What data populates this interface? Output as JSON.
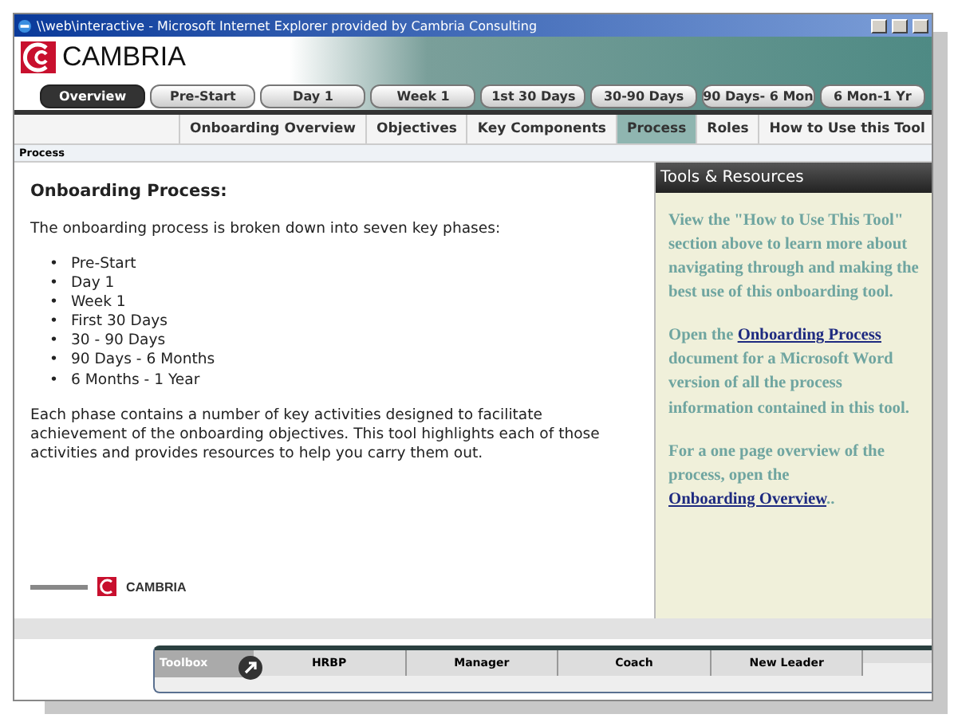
{
  "window": {
    "title": "\\\\web\\interactive - Microsoft Internet Explorer provided by Cambria Consulting"
  },
  "brand": {
    "name": "CAMBRIA"
  },
  "phase_tabs": [
    {
      "label": "Overview",
      "selected": true
    },
    {
      "label": "Pre-Start",
      "selected": false
    },
    {
      "label": "Day 1",
      "selected": false
    },
    {
      "label": "Week 1",
      "selected": false
    },
    {
      "label": "1st 30 Days",
      "selected": false
    },
    {
      "label": "30-90 Days",
      "selected": false
    },
    {
      "label": "90 Days- 6 Mon",
      "selected": false
    },
    {
      "label": "6 Mon-1 Yr",
      "selected": false
    }
  ],
  "section_tabs": [
    {
      "label": "Onboarding Overview",
      "selected": false
    },
    {
      "label": "Objectives",
      "selected": false
    },
    {
      "label": "Key Components",
      "selected": false
    },
    {
      "label": "Process",
      "selected": true
    },
    {
      "label": "Roles",
      "selected": false
    },
    {
      "label": "How to Use this Tool",
      "selected": false
    }
  ],
  "breadcrumb": "Process",
  "main": {
    "bullet": "•",
    "heading": "Onboarding Process:",
    "intro": "The onboarding process is broken down into seven key phases:",
    "phases": [
      "Pre-Start",
      "Day 1",
      "Week 1",
      "First 30 Days",
      "30 - 90 Days",
      "90 Days - 6 Months",
      "6 Months - 1 Year"
    ],
    "summary": "Each phase contains a number of key activities designed to facilitate achievement of the onboarding objectives. This tool highlights each of those activities and provides resources to help you carry them out.",
    "footer_brand": "CAMBRIA"
  },
  "sidebar": {
    "title": "Tools & Resources",
    "paragraphs": [
      {
        "before": "View the \"How to Use This Tool\" section above to learn more about navigating through and making the best use of this onboarding tool."
      },
      {
        "before": "Open the ",
        "link": "Onboarding Process",
        "after": " document for a Microsoft Word version of all the process information contained in this tool."
      },
      {
        "before": "For a one page overview of the process, open the ",
        "link": "Onboarding Overview",
        "after": ".."
      }
    ]
  },
  "toolbox": {
    "label": "Toolbox",
    "tabs": [
      "HRBP",
      "Manager",
      "Coach",
      "New Leader"
    ]
  }
}
